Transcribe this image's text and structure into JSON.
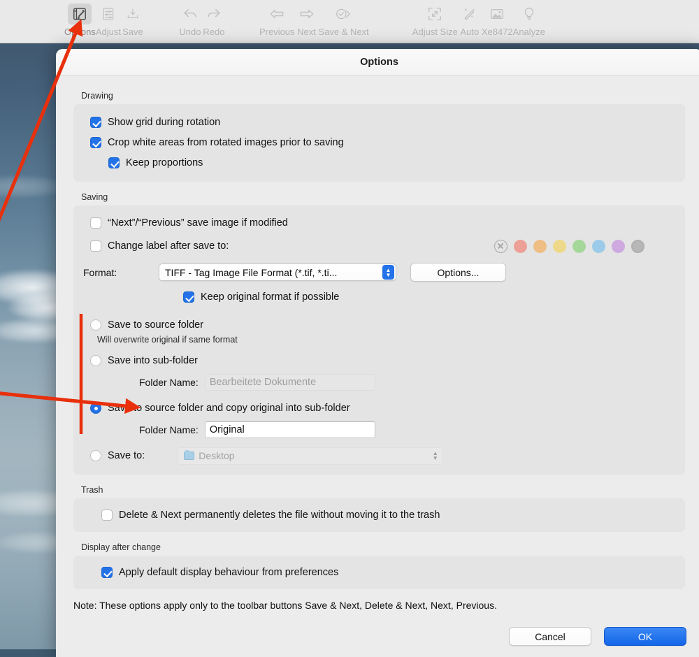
{
  "toolbar": {
    "items": [
      {
        "label": "Options",
        "icon": "options-icon",
        "active": true
      },
      {
        "label": "Adjust",
        "icon": "adjust-icon",
        "active": false
      },
      {
        "label": "Save",
        "icon": "save-icon",
        "active": false
      },
      {
        "label": "Undo",
        "icon": "undo-icon",
        "active": false
      },
      {
        "label": "Redo",
        "icon": "redo-icon",
        "active": false
      },
      {
        "label": "Previous",
        "icon": "arrow-left-icon",
        "active": false
      },
      {
        "label": "Next",
        "icon": "arrow-right-icon",
        "active": false
      },
      {
        "label": "Save & Next",
        "icon": "save-next-icon",
        "active": false
      },
      {
        "label": "Adjust Size",
        "icon": "expand-icon",
        "active": false
      },
      {
        "label": "Auto",
        "icon": "magic-wand-icon",
        "active": false
      },
      {
        "label": "Xe8472",
        "icon": "photo-icon",
        "active": false
      },
      {
        "label": "Analyze",
        "icon": "lightbulb-icon",
        "active": false
      }
    ]
  },
  "dialog": {
    "title": "Options",
    "drawing": {
      "group_label": "Drawing",
      "options": [
        {
          "label": "Show grid during rotation",
          "checked": true,
          "indent": 0
        },
        {
          "label": "Crop white areas from rotated images prior to saving",
          "checked": true,
          "indent": 0
        },
        {
          "label": "Keep proportions",
          "checked": true,
          "indent": 1
        }
      ]
    },
    "saving": {
      "group_label": "Saving",
      "next_prev_save": {
        "label": "“Next”/“Previous” save image if modified",
        "checked": false
      },
      "change_label": {
        "label": "Change label after save to:",
        "checked": false
      },
      "swatches": [
        {
          "name": "none",
          "color": "transparent",
          "selected": false
        },
        {
          "name": "red",
          "color": "#eda097",
          "selected": false
        },
        {
          "name": "orange",
          "color": "#eebe84",
          "selected": false
        },
        {
          "name": "yellow",
          "color": "#eed98a",
          "selected": false
        },
        {
          "name": "green",
          "color": "#a6d79a",
          "selected": false
        },
        {
          "name": "blue",
          "color": "#9bcbe8",
          "selected": false
        },
        {
          "name": "purple",
          "color": "#ceaae0",
          "selected": false
        },
        {
          "name": "gray",
          "color": "#b7b7b7",
          "selected": true
        }
      ],
      "format_label": "Format:",
      "format_value": "TIFF - Tag Image File Format (*.tif, *.ti...",
      "format_options_button": "Options...",
      "keep_original_format": {
        "label": "Keep original format if possible",
        "checked": true
      },
      "destination": {
        "selected_index": 2,
        "choices": [
          {
            "label": "Save to source folder",
            "sub_note": "Will overwrite original if same format"
          },
          {
            "label": "Save into sub-folder",
            "field_label": "Folder Name:",
            "field_value": "",
            "field_placeholder": "Bearbeitete Dokumente",
            "field_disabled": true
          },
          {
            "label": "Save to source folder and copy original into sub-folder",
            "field_label": "Folder Name:",
            "field_value": "Original",
            "field_placeholder": "",
            "field_disabled": false
          },
          {
            "label": "Save to:",
            "path_value": "Desktop",
            "path_disabled": true
          }
        ]
      }
    },
    "trash": {
      "group_label": "Trash",
      "option": {
        "label": "Delete & Next permanently deletes the file without moving it to the trash",
        "checked": false
      }
    },
    "display_after_change": {
      "group_label": "Display after change",
      "option": {
        "label": "Apply default display behaviour from preferences",
        "checked": true
      }
    },
    "note": "Note: These options apply only to the toolbar buttons Save & Next, Delete & Next, Next, Previous.",
    "footer": {
      "cancel_label": "Cancel",
      "ok_label": "OK"
    }
  },
  "annotations": {
    "accent_color": "#e8300c",
    "arrow_to_options_toolbar": "points to Options toolbar button",
    "arrow_to_folder_name": "points to Folder Name field of third save option",
    "bracket_destination_group": "vertical line beside destination radio group"
  }
}
